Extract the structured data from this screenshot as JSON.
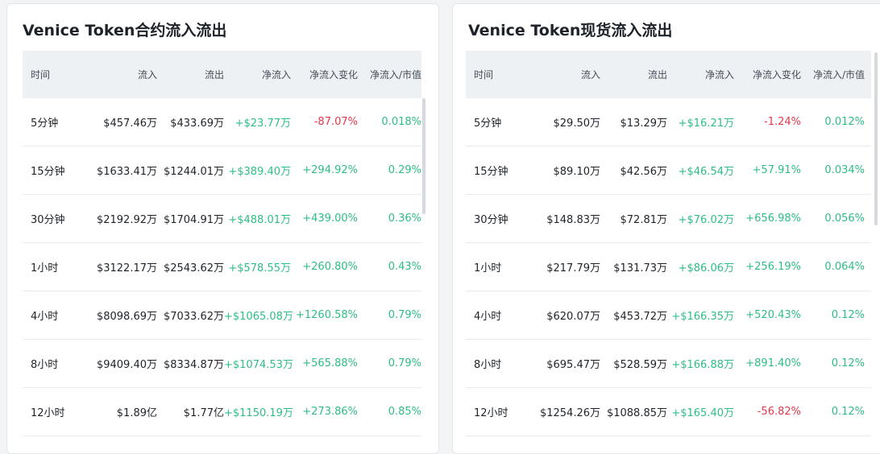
{
  "left": {
    "title": "Venice Token合约流入流出",
    "headers": [
      "时间",
      "流入",
      "流出",
      "净流入",
      "净流入变化",
      "净流入/市值"
    ],
    "rows": [
      {
        "time": "5分钟",
        "inflow": "$457.46万",
        "outflow": "$433.69万",
        "net": "+$23.77万",
        "change": "-87.07%",
        "ratio": "0.018%"
      },
      {
        "time": "15分钟",
        "inflow": "$1633.41万",
        "outflow": "$1244.01万",
        "net": "+$389.40万",
        "change": "+294.92%",
        "ratio": "0.29%"
      },
      {
        "time": "30分钟",
        "inflow": "$2192.92万",
        "outflow": "$1704.91万",
        "net": "+$488.01万",
        "change": "+439.00%",
        "ratio": "0.36%"
      },
      {
        "time": "1小时",
        "inflow": "$3122.17万",
        "outflow": "$2543.62万",
        "net": "+$578.55万",
        "change": "+260.80%",
        "ratio": "0.43%"
      },
      {
        "time": "4小时",
        "inflow": "$8098.69万",
        "outflow": "$7033.62万",
        "net": "+$1065.08万",
        "change": "+1260.58%",
        "ratio": "0.79%"
      },
      {
        "time": "8小时",
        "inflow": "$9409.40万",
        "outflow": "$8334.87万",
        "net": "+$1074.53万",
        "change": "+565.88%",
        "ratio": "0.79%"
      },
      {
        "time": "12小时",
        "inflow": "$1.89亿",
        "outflow": "$1.77亿",
        "net": "+$1150.19万",
        "change": "+273.86%",
        "ratio": "0.85%"
      }
    ]
  },
  "right": {
    "title": "Venice Token现货流入流出",
    "headers": [
      "时间",
      "流入",
      "流出",
      "净流入",
      "净流入变化",
      "净流入/市值"
    ],
    "rows": [
      {
        "time": "5分钟",
        "inflow": "$29.50万",
        "outflow": "$13.29万",
        "net": "+$16.21万",
        "change": "-1.24%",
        "ratio": "0.012%"
      },
      {
        "time": "15分钟",
        "inflow": "$89.10万",
        "outflow": "$42.56万",
        "net": "+$46.54万",
        "change": "+57.91%",
        "ratio": "0.034%"
      },
      {
        "time": "30分钟",
        "inflow": "$148.83万",
        "outflow": "$72.81万",
        "net": "+$76.02万",
        "change": "+656.98%",
        "ratio": "0.056%"
      },
      {
        "time": "1小时",
        "inflow": "$217.79万",
        "outflow": "$131.73万",
        "net": "+$86.06万",
        "change": "+256.19%",
        "ratio": "0.064%"
      },
      {
        "time": "4小时",
        "inflow": "$620.07万",
        "outflow": "$453.72万",
        "net": "+$166.35万",
        "change": "+520.43%",
        "ratio": "0.12%"
      },
      {
        "time": "8小时",
        "inflow": "$695.47万",
        "outflow": "$528.59万",
        "net": "+$166.88万",
        "change": "+891.40%",
        "ratio": "0.12%"
      },
      {
        "time": "12小时",
        "inflow": "$1254.26万",
        "outflow": "$1088.85万",
        "net": "+$165.40万",
        "change": "-56.82%",
        "ratio": "0.12%"
      }
    ]
  },
  "colors": {
    "positive": "#2ebd85",
    "negative": "#e0394a",
    "header_bg": "#eef1f4"
  }
}
